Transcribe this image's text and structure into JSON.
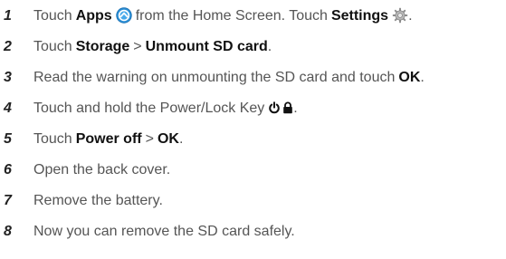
{
  "steps": [
    {
      "number": "1",
      "t1": "Touch",
      "b1": "Apps",
      "t2": "from the Home Screen. Touch",
      "b2": "Settings",
      "t3": "."
    },
    {
      "number": "2",
      "t1": "Touch",
      "b1": "Storage",
      "t2": ">",
      "b2": "Unmount SD card",
      "t3": "."
    },
    {
      "number": "3",
      "t1": "Read the warning on unmounting the SD card and touch",
      "b1": "OK",
      "t2": "."
    },
    {
      "number": "4",
      "t1": "Touch and hold the Power/Lock Key",
      "t2": "."
    },
    {
      "number": "5",
      "t1": "Touch",
      "b1": "Power off",
      "t2": ">",
      "b2": "OK",
      "t3": "."
    },
    {
      "number": "6",
      "t1": "Open the back cover."
    },
    {
      "number": "7",
      "t1": "Remove the battery."
    },
    {
      "number": "8",
      "t1": "Now you can remove the SD card safely."
    }
  ],
  "icons": {
    "apps": "apps-icon",
    "settings": "settings-icon",
    "power": "power-icon",
    "lock": "lock-icon"
  },
  "colors": {
    "apps_icon": "#2b8fd6",
    "text": "#555555",
    "bold_text": "#111111",
    "number": "#222222"
  }
}
